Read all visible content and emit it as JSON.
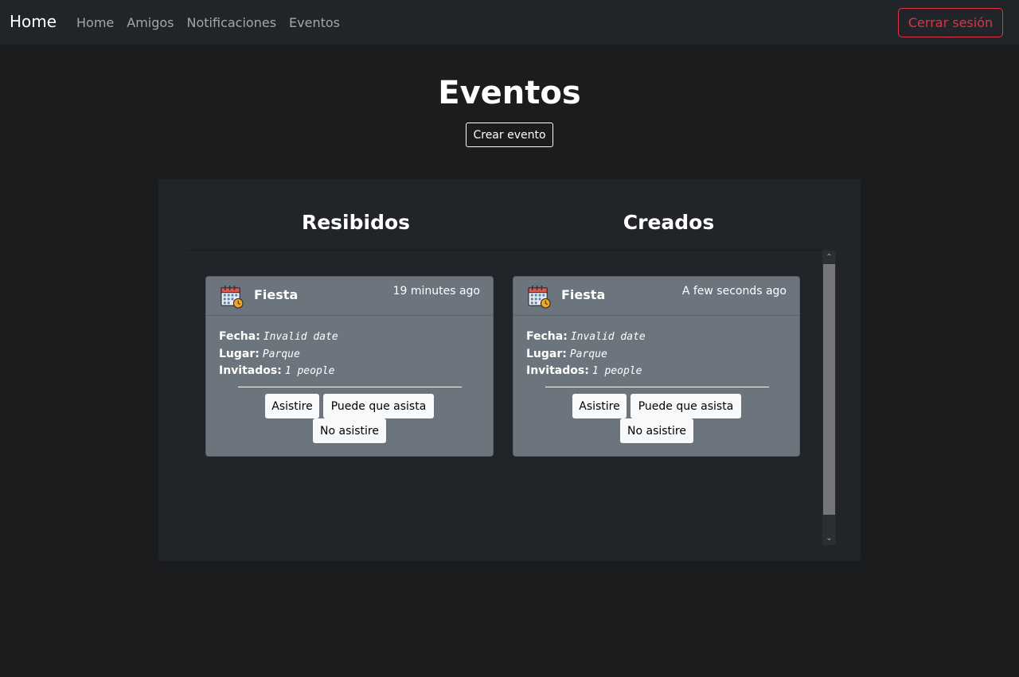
{
  "nav": {
    "brand": "Home",
    "links": [
      "Home",
      "Amigos",
      "Notificaciones",
      "Eventos"
    ],
    "logout_label": "Cerrar sesión"
  },
  "page": {
    "title": "Eventos",
    "create_label": "Crear evento"
  },
  "columns": {
    "received_title": "Resibidos",
    "created_title": "Creados"
  },
  "received_events": [
    {
      "title": "Fiesta",
      "time": "19 minutes ago",
      "fecha_label": "Fecha:",
      "fecha_value": "Invalid date",
      "lugar_label": "Lugar:",
      "lugar_value": "Parque",
      "invitados_label": "Invitados:",
      "invitados_value": "1 people",
      "buttons": [
        "Asistire",
        "Puede que asista",
        "No asistire"
      ]
    }
  ],
  "created_events": [
    {
      "title": "Fiesta",
      "time": "A few seconds ago",
      "fecha_label": "Fecha:",
      "fecha_value": "Invalid date",
      "lugar_label": "Lugar:",
      "lugar_value": "Parque",
      "invitados_label": "Invitados:",
      "invitados_value": "1 people",
      "buttons": [
        "Asistire",
        "Puede que asista",
        "No asistire"
      ]
    }
  ],
  "icons": {
    "event": "calendar-clock-icon",
    "scroll_up": "chevron-up-icon",
    "scroll_down": "chevron-down-icon"
  },
  "colors": {
    "background": "#1b1c1e",
    "navbar": "#212429",
    "panel": "#212429",
    "card": "#6c757d",
    "danger": "#dc3545"
  }
}
